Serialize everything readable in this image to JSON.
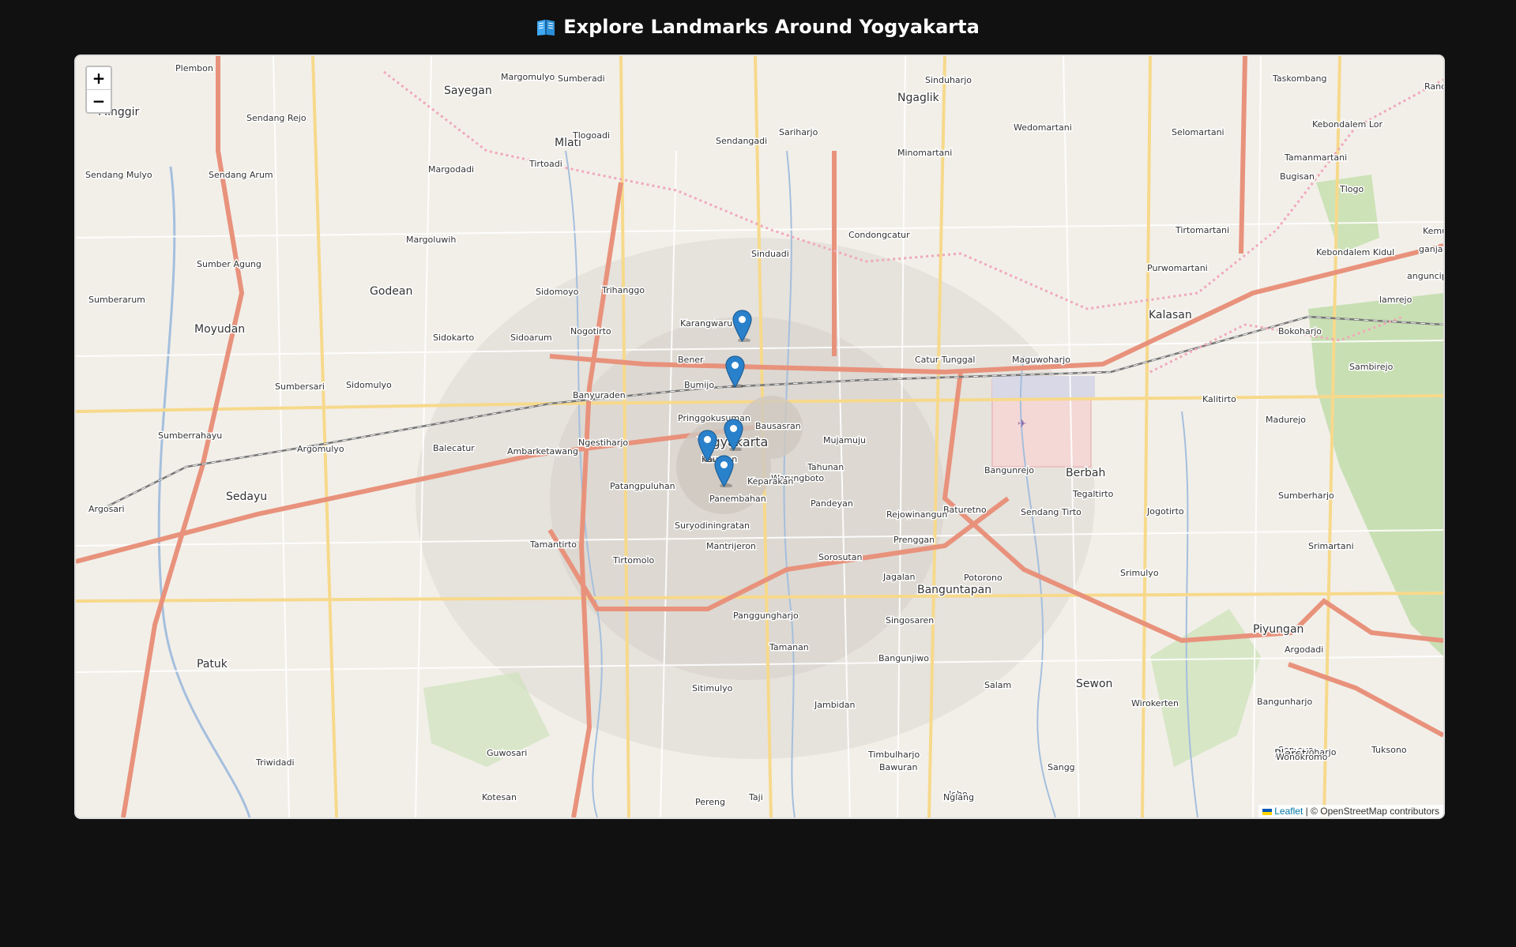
{
  "page": {
    "title": "Explore Landmarks Around Yogyakarta",
    "title_icon": "open-book-icon"
  },
  "map": {
    "zoom_in_label": "+",
    "zoom_out_label": "−",
    "attribution": {
      "leaflet": "Leaflet",
      "separator": " | ",
      "osm": "© OpenStreetMap contributors"
    },
    "markers_count": 5,
    "road_colors": {
      "primary": "#e8927c",
      "secondary": "#f7d98b",
      "minor": "#ffffff",
      "rail": "#777777",
      "river": "#a5bfdd"
    },
    "place_labels": [
      {
        "text": "Plembon"
      },
      {
        "text": "Margomulyo"
      },
      {
        "text": "Sumberadi"
      },
      {
        "text": "Sinduharjo"
      },
      {
        "text": "Taskombang"
      },
      {
        "text": "Minggir"
      },
      {
        "text": "Sayegan"
      },
      {
        "text": "Ngaglik"
      },
      {
        "text": "Sendang Rejo"
      },
      {
        "text": "Wedomartani"
      },
      {
        "text": "Selomartani"
      },
      {
        "text": "Kebondalem Lor"
      },
      {
        "text": "Mlati"
      },
      {
        "text": "Tlogoadi"
      },
      {
        "text": "Sariharjo"
      },
      {
        "text": "Sendangadi"
      },
      {
        "text": "Minomartani"
      },
      {
        "text": "Tamanmartani"
      },
      {
        "text": "Tirtoadi"
      },
      {
        "text": "Margodadi"
      },
      {
        "text": "Sendang Mulyo"
      },
      {
        "text": "Sendang Arum"
      },
      {
        "text": "Bugisan"
      },
      {
        "text": "Tlogo"
      },
      {
        "text": "Condongcatur"
      },
      {
        "text": "Tirtomartani"
      },
      {
        "text": "Margoluwih"
      },
      {
        "text": "Sinduadi"
      },
      {
        "text": "Sumber Agung"
      },
      {
        "text": "Kebondalem Kidul"
      },
      {
        "text": "Purwomartani"
      },
      {
        "text": "Godean"
      },
      {
        "text": "Trihanggo"
      },
      {
        "text": "Sidomoyo"
      },
      {
        "text": "Sumberarum"
      },
      {
        "text": "Moyudan"
      },
      {
        "text": "Karangwaru"
      },
      {
        "text": "Nogotirto"
      },
      {
        "text": "Sidokarto"
      },
      {
        "text": "Sidoarum"
      },
      {
        "text": "Kalasan"
      },
      {
        "text": "Bokoharjo"
      },
      {
        "text": "Catur Tunggal"
      },
      {
        "text": "Maguwoharjo"
      },
      {
        "text": "Bener"
      },
      {
        "text": "Sambirejo"
      },
      {
        "text": "Sidomulyo"
      },
      {
        "text": "Sumbersari"
      },
      {
        "text": "Bumijo"
      },
      {
        "text": "Banyuraden"
      },
      {
        "text": "Kalitirto"
      },
      {
        "text": "Pringgokusuman"
      },
      {
        "text": "Bausasran"
      },
      {
        "text": "Madurejo"
      },
      {
        "text": "Sumberrahayu"
      },
      {
        "text": "Ngestiharjo"
      },
      {
        "text": "Yogyakarta"
      },
      {
        "text": "Mujamuju"
      },
      {
        "text": "Argomulyo"
      },
      {
        "text": "Balecatur"
      },
      {
        "text": "Ambarketawang"
      },
      {
        "text": "Berbah"
      },
      {
        "text": "Tahunan"
      },
      {
        "text": "Kauman"
      },
      {
        "text": "Bangunrejo"
      },
      {
        "text": "Sedayu"
      },
      {
        "text": "Patangpuluhan"
      },
      {
        "text": "Warungboto"
      },
      {
        "text": "Keparakan"
      },
      {
        "text": "Tegaltirto"
      },
      {
        "text": "Panembahan"
      },
      {
        "text": "Pandeyan"
      },
      {
        "text": "Sumberharjo"
      },
      {
        "text": "Argosari"
      },
      {
        "text": "Baturetno"
      },
      {
        "text": "Sendang Tirto"
      },
      {
        "text": "Jogotirto"
      },
      {
        "text": "Rejowinangun"
      },
      {
        "text": "Suryodiningratan"
      },
      {
        "text": "Tamantirto"
      },
      {
        "text": "Mantrijeron"
      },
      {
        "text": "Prenggan"
      },
      {
        "text": "Sorosutan"
      },
      {
        "text": "Srimartani"
      },
      {
        "text": "Tirtomolo"
      },
      {
        "text": "Jagalan"
      },
      {
        "text": "Banguntapan"
      },
      {
        "text": "Potorono"
      },
      {
        "text": "Srimulyo"
      },
      {
        "text": "Singosaren"
      },
      {
        "text": "Panggungharjo"
      },
      {
        "text": "Piyungan"
      },
      {
        "text": "Tamanan"
      },
      {
        "text": "Bangunjiwo"
      },
      {
        "text": "Argodadi"
      },
      {
        "text": "Patuk"
      },
      {
        "text": "Sitimulyo"
      },
      {
        "text": "Salam"
      },
      {
        "text": "Sewon"
      },
      {
        "text": "Jambidan"
      },
      {
        "text": "Wirokerten"
      },
      {
        "text": "Bangunharjo"
      },
      {
        "text": "Triwidadi"
      },
      {
        "text": "Tuksono"
      },
      {
        "text": "Semoyo"
      },
      {
        "text": "Pendowoharjo"
      },
      {
        "text": "Pleret"
      },
      {
        "text": "Wonokromo"
      },
      {
        "text": "Guwosari"
      },
      {
        "text": "Timbulharjo"
      },
      {
        "text": "Bawuran"
      },
      {
        "text": "Sangg"
      },
      {
        "text": "Joho"
      },
      {
        "text": "Taji"
      },
      {
        "text": "Kotesan"
      },
      {
        "text": "Pereng"
      },
      {
        "text": "Nglang"
      },
      {
        "text": "Kemu"
      },
      {
        "text": "Rand"
      },
      {
        "text": "ganjang"
      },
      {
        "text": "anguncipto"
      },
      {
        "text": "lamrejo"
      }
    ]
  }
}
